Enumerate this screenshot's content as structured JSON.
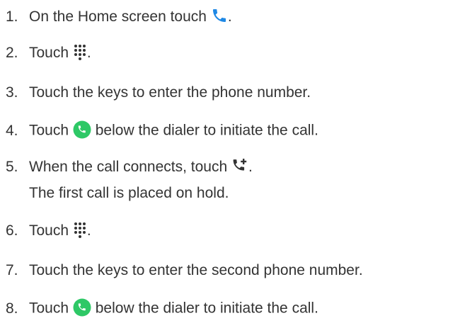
{
  "colors": {
    "text": "#333333",
    "phone_blue": "#1e88e5",
    "call_green": "#2ec866",
    "icon_dark": "#333333"
  },
  "icons": {
    "phone": "phone-icon",
    "dialpad": "dialpad-icon",
    "call_button": "green-call-button-icon",
    "add_call": "add-call-icon"
  },
  "steps": [
    {
      "number": "1.",
      "before": "On the Home screen touch",
      "after": "."
    },
    {
      "number": "2.",
      "before": "Touch",
      "after": "."
    },
    {
      "number": "3.",
      "text": "Touch the keys to enter the phone number."
    },
    {
      "number": "4.",
      "before": "Touch",
      "after": "below the dialer to initiate the call."
    },
    {
      "number": "5.",
      "before": "When the call connects, touch",
      "after": ".",
      "note": "The first call is placed on hold."
    },
    {
      "number": "6.",
      "before": "Touch",
      "after": "."
    },
    {
      "number": "7.",
      "text": "Touch the keys to enter the second phone number."
    },
    {
      "number": "8.",
      "before": "Touch",
      "after": "below the dialer to initiate the call."
    }
  ]
}
